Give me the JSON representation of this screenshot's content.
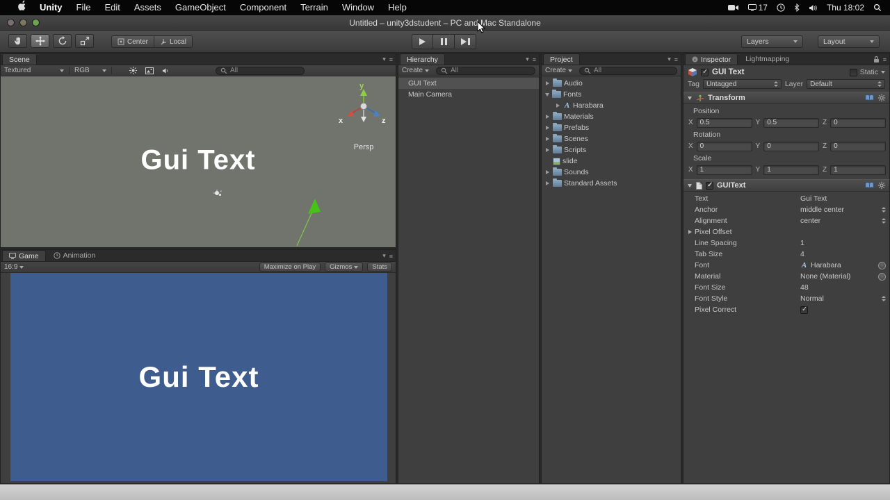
{
  "menubar": {
    "items": [
      "Unity",
      "File",
      "Edit",
      "Assets",
      "GameObject",
      "Component",
      "Terrain",
      "Window",
      "Help"
    ],
    "status": {
      "recording_count": "17",
      "clock": "Thu 18:02"
    }
  },
  "window": {
    "title": "Untitled – unity3dstudent – PC and Mac Standalone"
  },
  "toolbar": {
    "pivot_label": "Center",
    "space_label": "Local",
    "layers_label": "Layers",
    "layout_label": "Layout"
  },
  "scene": {
    "tab": "Scene",
    "draw_mode": "Textured",
    "channel": "RGB",
    "search_text": "All",
    "canvas_text": "Gui Text",
    "camera_label": "Persp",
    "axis": {
      "x": "x",
      "y": "y",
      "z": "z"
    }
  },
  "game": {
    "tab": "Game",
    "animation_tab": "Animation",
    "aspect": "16:9",
    "maximize_label": "Maximize on Play",
    "gizmos_label": "Gizmos",
    "stats_label": "Stats",
    "canvas_text": "Gui Text"
  },
  "hierarchy": {
    "tab": "Hierarchy",
    "create_label": "Create",
    "search_text": "All",
    "items": [
      {
        "label": "GUI Text"
      },
      {
        "label": "Main Camera"
      }
    ]
  },
  "project": {
    "tab": "Project",
    "create_label": "Create",
    "search_text": "All",
    "items": [
      {
        "label": "Audio"
      },
      {
        "label": "Fonts"
      },
      {
        "label": "Harabara"
      },
      {
        "label": "Materials"
      },
      {
        "label": "Prefabs"
      },
      {
        "label": "Scenes"
      },
      {
        "label": "Scripts"
      },
      {
        "label": "slide"
      },
      {
        "label": "Sounds"
      },
      {
        "label": "Standard Assets"
      }
    ]
  },
  "inspector": {
    "tab": "Inspector",
    "lightmapping_tab": "Lightmapping",
    "object_name": "GUI Text",
    "static_label": "Static",
    "tag_label": "Tag",
    "tag_value": "Untagged",
    "layer_label": "Layer",
    "layer_value": "Default",
    "axis": {
      "x": "X",
      "y": "Y",
      "z": "Z"
    },
    "transform": {
      "title": "Transform",
      "position": {
        "label": "Position",
        "x": "0.5",
        "y": "0.5",
        "z": "0"
      },
      "rotation": {
        "label": "Rotation",
        "x": "0",
        "y": "0",
        "z": "0"
      },
      "scale": {
        "label": "Scale",
        "x": "1",
        "y": "1",
        "z": "1"
      }
    },
    "guitext": {
      "title": "GUIText",
      "rows": [
        {
          "label": "Text",
          "value": "Gui Text"
        },
        {
          "label": "Anchor",
          "value": "middle center"
        },
        {
          "label": "Alignment",
          "value": "center"
        },
        {
          "label": "Pixel Offset",
          "value": ""
        },
        {
          "label": "Line Spacing",
          "value": "1"
        },
        {
          "label": "Tab Size",
          "value": "4"
        },
        {
          "label": "Font",
          "value": "Harabara"
        },
        {
          "label": "Material",
          "value": "None (Material)"
        },
        {
          "label": "Font Size",
          "value": "48"
        },
        {
          "label": "Font Style",
          "value": "Normal"
        },
        {
          "label": "Pixel Correct",
          "value": ""
        }
      ]
    }
  }
}
